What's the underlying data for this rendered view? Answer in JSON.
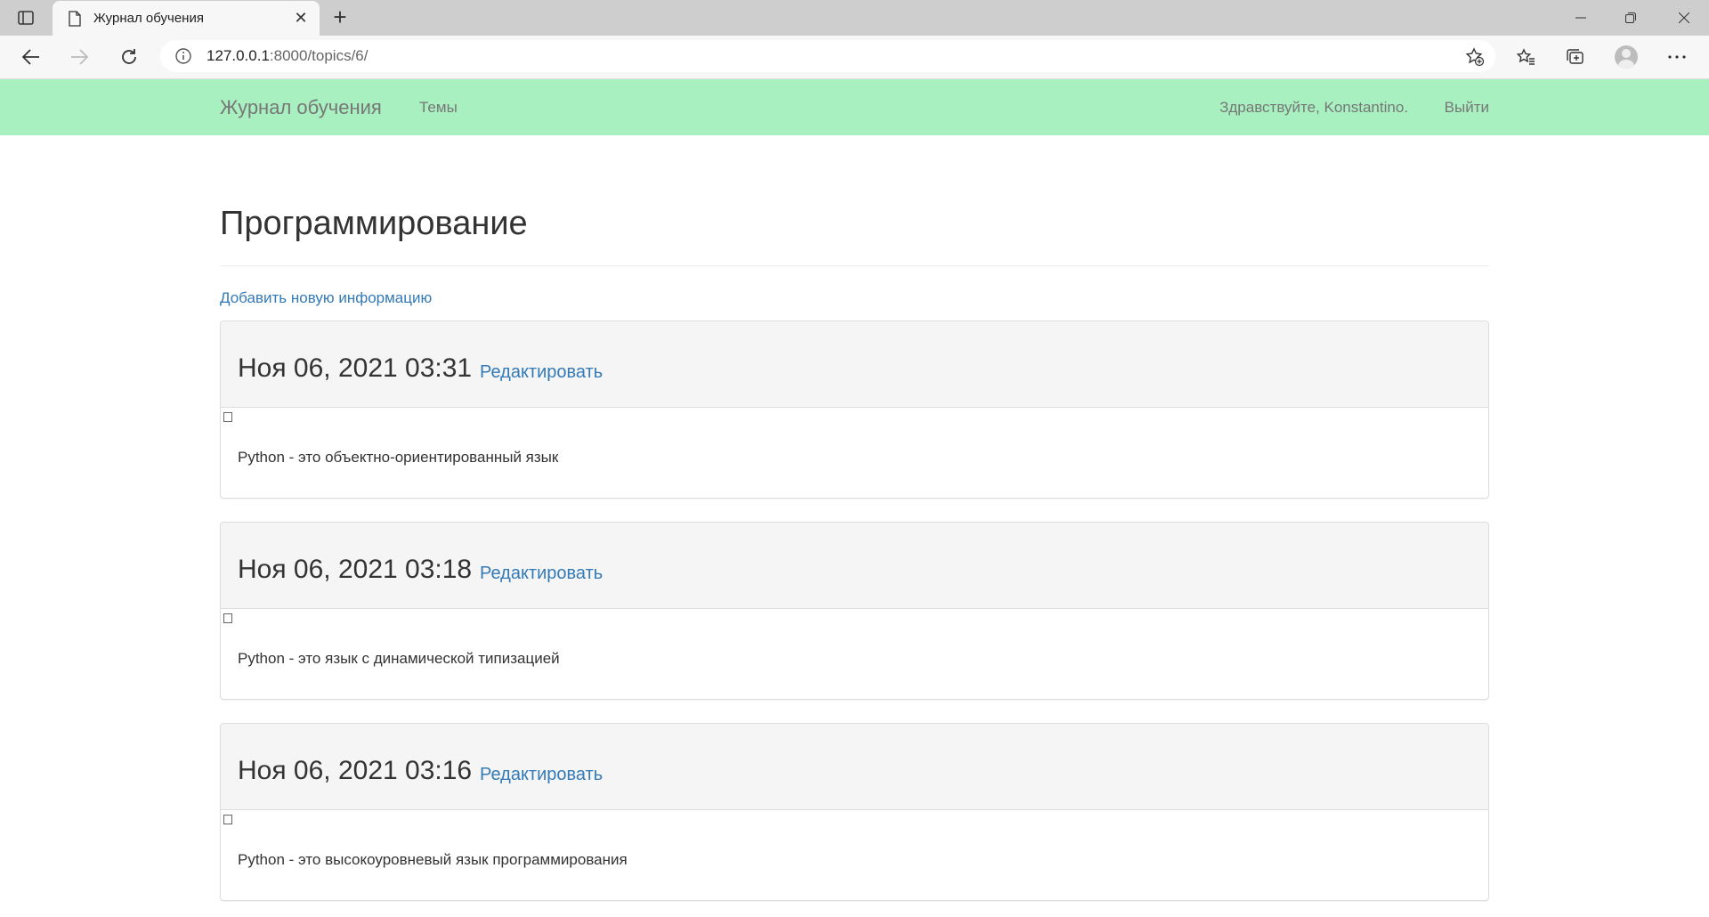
{
  "browser": {
    "tab_title": "Журнал обучения",
    "url_host": "127.0.0.1",
    "url_rest": ":8000/topics/6/"
  },
  "site": {
    "brand": "Журнал обучения",
    "nav_topics": "Темы",
    "greeting": "Здравствуйте, Konstantino.",
    "logout": "Выйти"
  },
  "page": {
    "title": "Программирование",
    "add_link": "Добавить новую информацию",
    "edit_label": "Редактировать"
  },
  "entries": [
    {
      "date": "Ноя 06, 2021 03:31",
      "text": "Python - это объектно-ориентированный язык"
    },
    {
      "date": "Ноя 06, 2021 03:18",
      "text": "Python - это язык с динамической типизацией"
    },
    {
      "date": "Ноя 06, 2021 03:16",
      "text": "Python - это высокоуровневый язык программирования"
    }
  ]
}
